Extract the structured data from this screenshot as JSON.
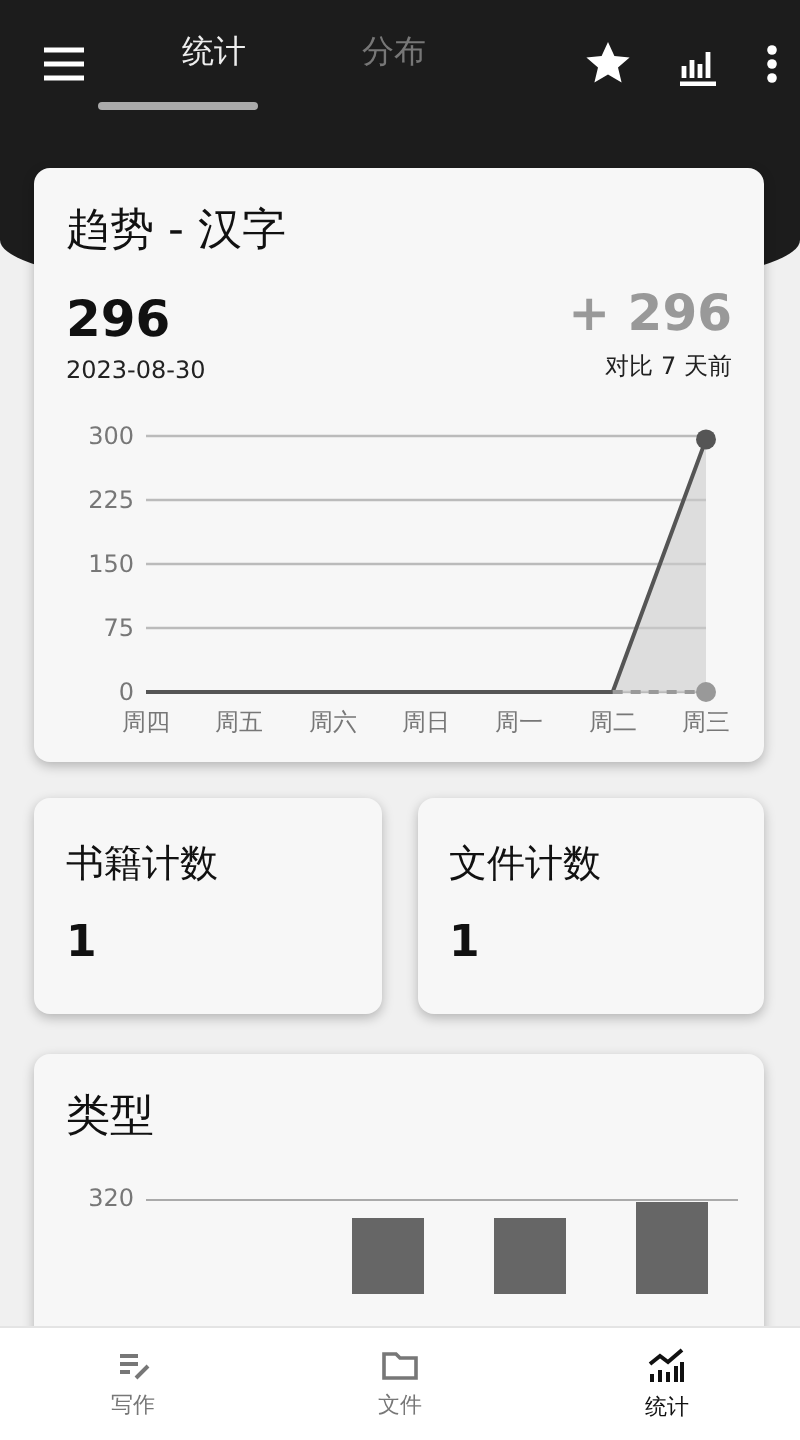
{
  "top_bar": {
    "tabs": [
      {
        "label": "统计",
        "selected": true
      },
      {
        "label": "分布",
        "selected": false
      }
    ]
  },
  "trend_card": {
    "title": "趋势 - 汉字",
    "count": "296",
    "date": "2023-08-30",
    "change": "+ 296",
    "change_caption": "对比 7 天前",
    "chart_data": {
      "type": "line",
      "categories": [
        "周四",
        "周五",
        "周六",
        "周日",
        "周一",
        "周二",
        "周三"
      ],
      "ylim": [
        0,
        300
      ],
      "grid": true,
      "yticks": [
        0,
        75,
        150,
        225,
        300
      ],
      "series": [
        {
          "color": "#555555",
          "line_style": "solid",
          "values": [
            0,
            0,
            0,
            0,
            0,
            0,
            296
          ]
        },
        {
          "color": "#999999",
          "line_style": "dashed",
          "values": [
            null,
            null,
            null,
            null,
            null,
            0,
            0
          ]
        }
      ]
    }
  },
  "stat_cards": [
    {
      "title": "书籍计数",
      "value": "1"
    },
    {
      "title": "文件计数",
      "value": "1"
    }
  ],
  "type_card": {
    "title": "类型",
    "tick": "320"
  },
  "bottom_nav": [
    {
      "kind": "write",
      "label": "写作",
      "selected": false
    },
    {
      "kind": "files",
      "label": "文件",
      "selected": false
    },
    {
      "kind": "stats",
      "label": "统计",
      "selected": true
    }
  ]
}
